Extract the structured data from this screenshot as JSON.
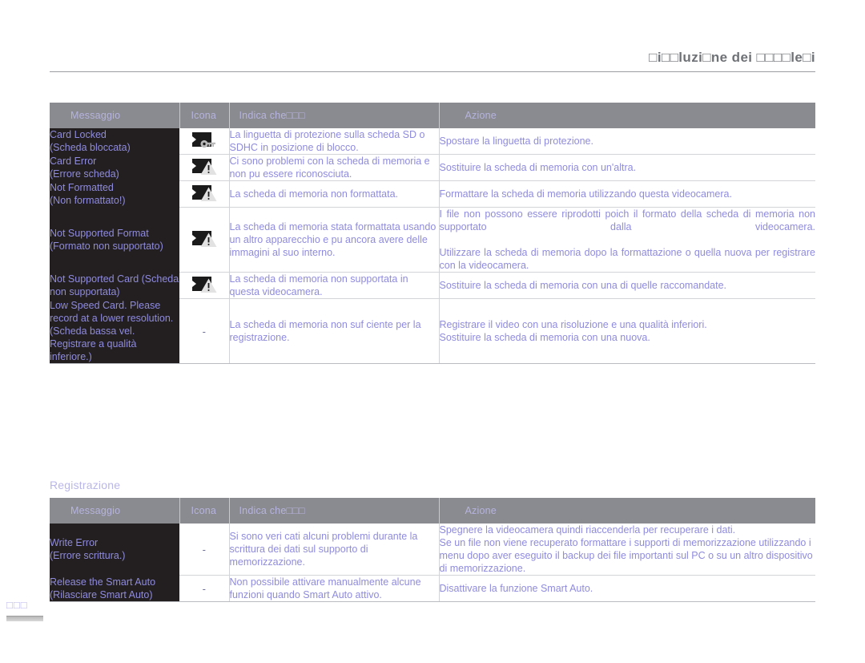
{
  "header": {
    "title": "□i□□luzi□ne dei □□□□le□i"
  },
  "page_number": "□□□",
  "columns": {
    "message": "Messaggio",
    "icon": "Icona",
    "means": "Indica che□□□",
    "action": "Azione"
  },
  "sections": [
    {
      "id": "storage",
      "title": "",
      "rows": [
        {
          "message": "Card Locked\n(Scheda bloccata)",
          "icon": "card-locked-icon",
          "means": "La linguetta di protezione sulla scheda SD o SDHC  in posizione di blocco.",
          "action": "Spostare la linguetta di protezione."
        },
        {
          "message": "Card Error\n(Errore scheda)",
          "icon": "card-warning-icon",
          "means": "Ci sono problemi con la scheda di memoria e non pu essere riconosciuta.",
          "action": "Sostituire la scheda di memoria con un'altra."
        },
        {
          "message": "Not Formatted\n(Non formattato!)",
          "icon": "card-warning-icon",
          "means": "La scheda di memoria non  formattata.",
          "action": "Formattare la scheda di memoria utilizzando questa videocamera."
        },
        {
          "message": "Not Supported Format\n(Formato non supportato)",
          "icon": "card-warning-icon",
          "means": "La scheda di memoria  stata formattata usando un altro apparecchio e pu ancora avere delle immagini al suo interno.",
          "action": "I file non possono essere riprodotti poich il formato della scheda di memoria non  supportato dalla videocamera.\nUtilizzare la scheda di memoria dopo la formattazione o quella nuova per registrare con la videocamera."
        },
        {
          "message": "Not Supported Card (Scheda non supportata)",
          "icon": "card-warning-icon",
          "means": "La scheda di memoria non  supportata in questa videocamera.",
          "action": "Sostituire la scheda di memoria con una di quelle raccomandate."
        },
        {
          "message": "Low Speed Card. Please record at a lower resolution. (Scheda bassa vel. Registrare a qualità inferiore.)",
          "icon": "dash",
          "means": "La scheda di memoria non  suf ciente per la registrazione.",
          "action": "Registrare il video con una risoluzione e una qualità inferiori.\nSostituire la scheda di memoria con una nuova."
        }
      ]
    },
    {
      "id": "recording",
      "title": "Registrazione",
      "rows": [
        {
          "message": "Write Error\n(Errore scrittura.)",
          "icon": "dash",
          "means": "Si sono veri cati alcuni problemi durante la scrittura dei dati sul supporto di memorizzazione.",
          "action": "Spegnere la videocamera  quindi riaccenderla per recuperare i dati.\nSe un file non viene recuperato  formattare i supporti di memorizzazione utilizzando i menu dopo aver eseguito il backup dei file importanti sul PC o su un altro dispositivo di memorizzazione."
        },
        {
          "message": "Release the Smart Auto (Rilasciare Smart Auto)",
          "icon": "dash",
          "means": "Non  possibile attivare manualmente alcune funzioni quando Smart Auto  attivo.",
          "action": "Disattivare la funzione Smart Auto."
        }
      ]
    }
  ],
  "colors": {
    "text_purple": "#8f8bdd",
    "header_gray": "#8a8b90",
    "message_bg": "#231f20",
    "title_gray": "#6e7176",
    "light_purple": "#b9b6e8"
  },
  "icon_dash": "-"
}
